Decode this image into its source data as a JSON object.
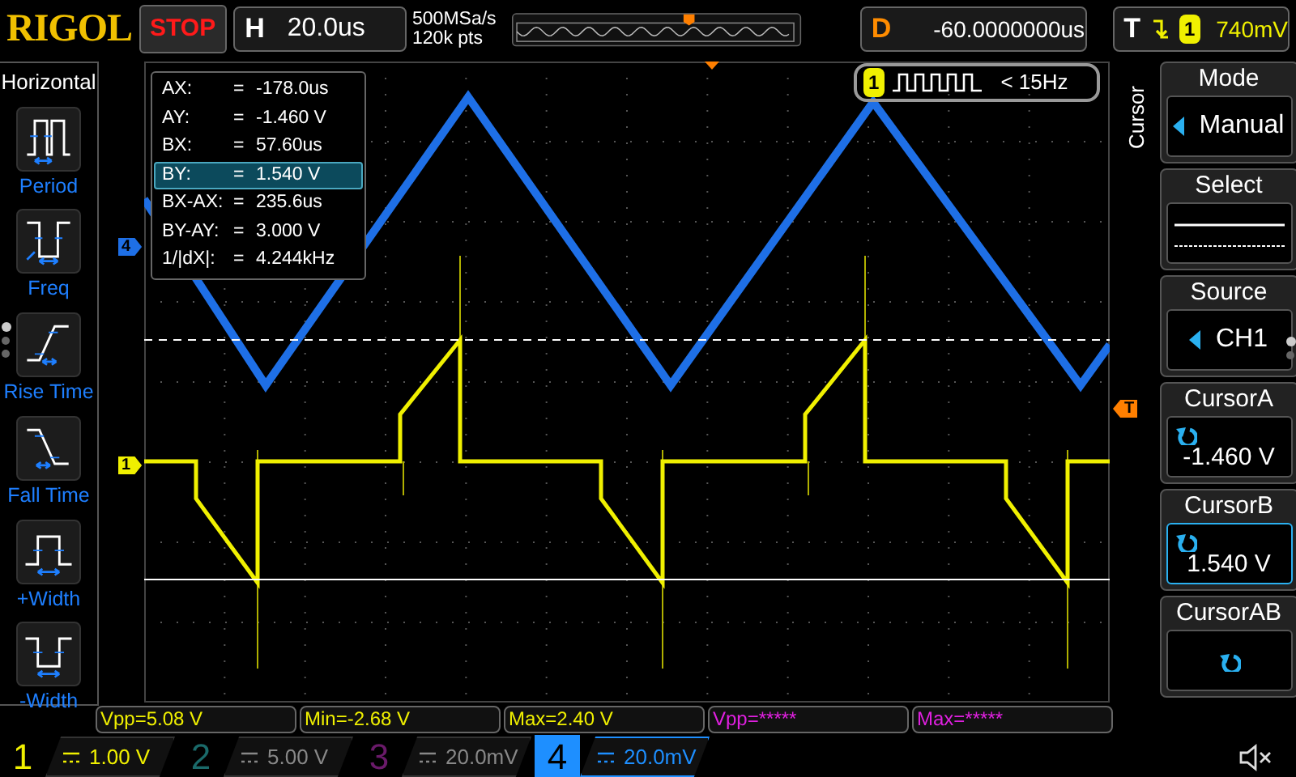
{
  "brand": "RIGOL",
  "run_state": "STOP",
  "timebase": {
    "label": "H",
    "value": "20.0us"
  },
  "acquisition": {
    "sample_rate": "500MSa/s",
    "memory_depth": "120k pts"
  },
  "delay": {
    "label": "D",
    "value": "-60.0000000us"
  },
  "trigger": {
    "label": "T",
    "channel": "1",
    "level": "740mV"
  },
  "measure_menu": {
    "title": "Horizontal",
    "items": [
      {
        "kind": "period",
        "label": "Period"
      },
      {
        "kind": "freq",
        "label": "Freq"
      },
      {
        "kind": "rise",
        "label": "Rise Time"
      },
      {
        "kind": "fall",
        "label": "Fall Time"
      },
      {
        "kind": "pwidth",
        "label": "+Width"
      },
      {
        "kind": "nwidth",
        "label": "-Width"
      }
    ]
  },
  "cursor_readout": [
    {
      "name": "AX:",
      "equals": "=",
      "value": "-178.0us",
      "selected": false
    },
    {
      "name": "AY:",
      "equals": "=",
      "value": "-1.460 V",
      "selected": false
    },
    {
      "name": "BX:",
      "equals": "=",
      "value": "57.60us",
      "selected": false
    },
    {
      "name": "BY:",
      "equals": "=",
      "value": "1.540 V",
      "selected": true
    },
    {
      "name": "BX-AX:",
      "equals": "=",
      "value": "235.6us",
      "selected": false
    },
    {
      "name": "BY-AY:",
      "equals": "=",
      "value": "3.000 V",
      "selected": false
    },
    {
      "name": "1/|dX|:",
      "equals": "=",
      "value": "4.244kHz",
      "selected": false
    }
  ],
  "frequency_counter": {
    "channel": "1",
    "value": "< 15Hz"
  },
  "trace_markers": [
    {
      "label": "4",
      "color": "#1e6fe6"
    },
    {
      "label": "1",
      "color": "#f0f000"
    },
    {
      "label": "T",
      "color": "#ff7f00"
    }
  ],
  "softkey_menu": {
    "title": "Cursor",
    "items": [
      {
        "kind": "choice",
        "label": "Mode",
        "value": "Manual"
      },
      {
        "kind": "lines",
        "label": "Select"
      },
      {
        "kind": "choice",
        "label": "Source",
        "value": "CH1"
      },
      {
        "kind": "knob",
        "label": "CursorA",
        "value": "-1.460 V",
        "selected": false
      },
      {
        "kind": "knob",
        "label": "CursorB",
        "value": "1.540 V",
        "selected": true
      },
      {
        "kind": "knob",
        "label": "CursorAB",
        "selected": false
      }
    ]
  },
  "measurements": [
    {
      "text": "Vpp=5.08 V",
      "color": "#f0f000"
    },
    {
      "text": "Min=-2.68 V",
      "color": "#f0f000"
    },
    {
      "text": "Max=2.40 V",
      "color": "#f0f000"
    },
    {
      "text": "Vpp=*****",
      "color": "#e020e0"
    },
    {
      "text": "Max=*****",
      "color": "#e020e0"
    }
  ],
  "channels": [
    {
      "number": "1",
      "scale": "1.00 V",
      "on": true,
      "selected": false,
      "color": "#f0f000"
    },
    {
      "number": "2",
      "scale": "5.00 V",
      "on": false,
      "selected": false,
      "color": "#1a6a6a"
    },
    {
      "number": "3",
      "scale": "20.0mV",
      "on": false,
      "selected": false,
      "color": "#6a1a6a"
    },
    {
      "number": "4",
      "scale": "20.0mV",
      "on": true,
      "selected": true,
      "color": "#1e8fff"
    }
  ]
}
